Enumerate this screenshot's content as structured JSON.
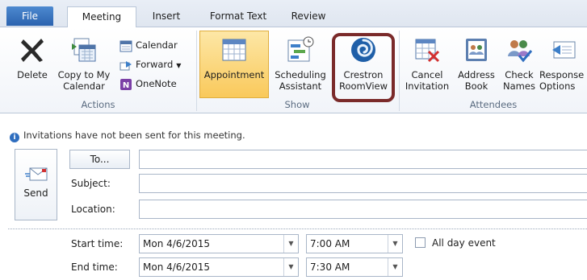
{
  "tabs": [
    "File",
    "Meeting",
    "Insert",
    "Format Text",
    "Review"
  ],
  "ribbon": {
    "actions": {
      "delete_label": "Delete",
      "copy_line1": "Copy to My",
      "copy_line2": "Calendar",
      "calendar_label": "Calendar",
      "forward_label": "Forward",
      "onenote_label": "OneNote",
      "group_label": "Actions"
    },
    "show": {
      "appointment_label": "Appointment",
      "scheduling_line1": "Scheduling",
      "scheduling_line2": "Assistant",
      "crestron_line1": "Crestron",
      "crestron_line2": "RoomView",
      "group_label": "Show"
    },
    "attendees": {
      "cancel_line1": "Cancel",
      "cancel_line2": "Invitation",
      "address_line1": "Address",
      "address_line2": "Book",
      "check_line1": "Check",
      "check_line2": "Names",
      "response_line1": "Response",
      "response_line2": "Options",
      "group_label": "Attendees"
    }
  },
  "info_message": "Invitations have not been sent for this meeting.",
  "form": {
    "send_label": "Send",
    "to_label": "To...",
    "subject_label": "Subject:",
    "location_label": "Location:",
    "start_label": "Start time:",
    "end_label": "End time:",
    "start_date": "Mon 4/6/2015",
    "start_time": "7:00 AM",
    "end_date": "Mon 4/6/2015",
    "end_time": "7:30 AM",
    "all_day_label": "All day event"
  },
  "colors": {
    "file_tab": "#2b63ae",
    "highlight": "#7a2a2a",
    "appointment_active": "#f9c95b"
  }
}
